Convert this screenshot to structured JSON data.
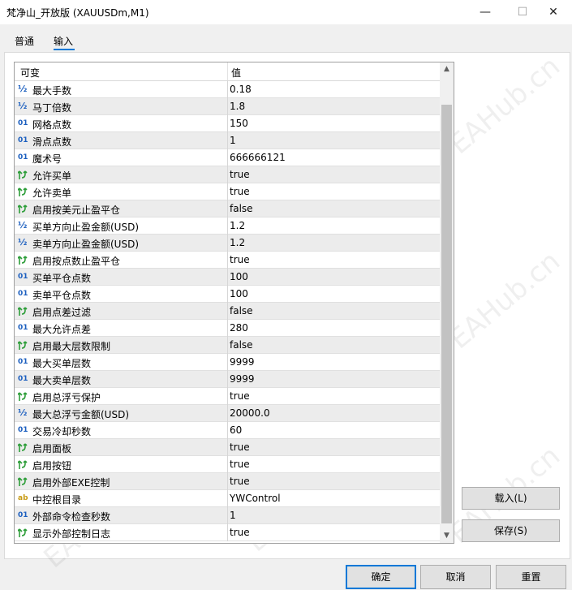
{
  "window": {
    "title": "梵净山_开放版 (XAUUSDm,M1)",
    "minimize_glyph": "—",
    "maximize_glyph": "☐",
    "close_glyph": "✕"
  },
  "tabs": [
    {
      "label": "普通",
      "active": false
    },
    {
      "label": "输入",
      "active": true
    }
  ],
  "grid": {
    "headers": {
      "variable": "可变",
      "value": "值"
    },
    "rows": [
      {
        "type": "half",
        "icon": "double-type-icon",
        "name": "最大手数",
        "value": "0.18"
      },
      {
        "type": "half",
        "icon": "double-type-icon",
        "name": "马丁倍数",
        "value": "1.8"
      },
      {
        "type": "int",
        "icon": "int-type-icon",
        "name": "网格点数",
        "value": "150"
      },
      {
        "type": "int",
        "icon": "int-type-icon",
        "name": "滑点点数",
        "value": "1"
      },
      {
        "type": "int",
        "icon": "int-type-icon",
        "name": "魔术号",
        "value": "666666121"
      },
      {
        "type": "bool",
        "icon": "bool-type-icon",
        "name": "允许买单",
        "value": "true"
      },
      {
        "type": "bool",
        "icon": "bool-type-icon",
        "name": "允许卖单",
        "value": "true"
      },
      {
        "type": "bool",
        "icon": "bool-type-icon",
        "name": "启用按美元止盈平仓",
        "value": "false"
      },
      {
        "type": "half",
        "icon": "double-type-icon",
        "name": "买单方向止盈金额(USD)",
        "value": "1.2"
      },
      {
        "type": "half",
        "icon": "double-type-icon",
        "name": "卖单方向止盈金额(USD)",
        "value": "1.2"
      },
      {
        "type": "bool",
        "icon": "bool-type-icon",
        "name": "启用按点数止盈平仓",
        "value": "true"
      },
      {
        "type": "int",
        "icon": "int-type-icon",
        "name": "买单平仓点数",
        "value": "100"
      },
      {
        "type": "int",
        "icon": "int-type-icon",
        "name": "卖单平仓点数",
        "value": "100"
      },
      {
        "type": "bool",
        "icon": "bool-type-icon",
        "name": "启用点差过滤",
        "value": "false"
      },
      {
        "type": "int",
        "icon": "int-type-icon",
        "name": "最大允许点差",
        "value": "280"
      },
      {
        "type": "bool",
        "icon": "bool-type-icon",
        "name": "启用最大层数限制",
        "value": "false"
      },
      {
        "type": "int",
        "icon": "int-type-icon",
        "name": "最大买单层数",
        "value": "9999"
      },
      {
        "type": "int",
        "icon": "int-type-icon",
        "name": "最大卖单层数",
        "value": "9999"
      },
      {
        "type": "bool",
        "icon": "bool-type-icon",
        "name": "启用总浮亏保护",
        "value": "true"
      },
      {
        "type": "half",
        "icon": "double-type-icon",
        "name": "最大总浮亏金额(USD)",
        "value": "20000.0"
      },
      {
        "type": "int",
        "icon": "int-type-icon",
        "name": "交易冷却秒数",
        "value": "60"
      },
      {
        "type": "bool",
        "icon": "bool-type-icon",
        "name": "启用面板",
        "value": "true"
      },
      {
        "type": "bool",
        "icon": "bool-type-icon",
        "name": "启用按钮",
        "value": "true"
      },
      {
        "type": "bool",
        "icon": "bool-type-icon",
        "name": "启用外部EXE控制",
        "value": "true"
      },
      {
        "type": "str",
        "icon": "string-type-icon",
        "name": "中控根目录",
        "value": "YWControl"
      },
      {
        "type": "int",
        "icon": "int-type-icon",
        "name": "外部命令检查秒数",
        "value": "1"
      },
      {
        "type": "bool",
        "icon": "bool-type-icon",
        "name": "显示外部控制日志",
        "value": "true"
      }
    ],
    "icon_glyphs": {
      "half": "½",
      "int": "01",
      "str": "ab"
    }
  },
  "side_buttons": {
    "load": "载入(L)",
    "save": "保存(S)"
  },
  "bottom_buttons": {
    "ok": "确定",
    "cancel": "取消",
    "reset": "重置"
  },
  "watermark": "EAHub.cn",
  "colors": {
    "accent": "#0078d7",
    "type_icon_blue": "#1c5fbf",
    "bool_icon_green": "#2e9e3a",
    "string_icon_gold": "#c79a12"
  }
}
